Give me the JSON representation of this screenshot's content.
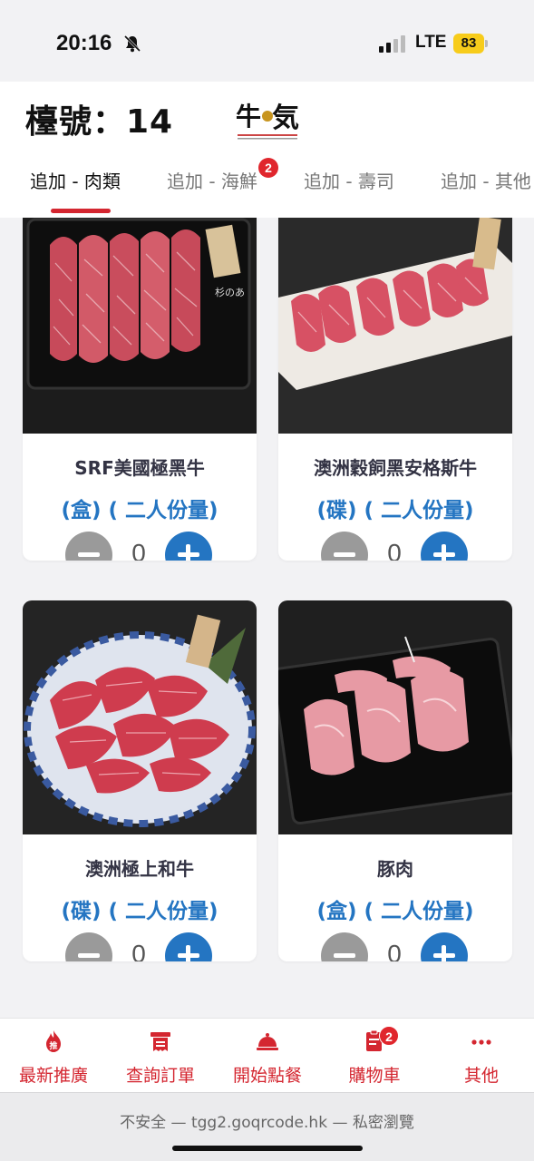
{
  "status": {
    "time": "20:16",
    "network": "LTE",
    "battery": "83"
  },
  "header": {
    "table_label": "檯號：14",
    "tabs": [
      {
        "label": "追加 - 肉類",
        "active": true
      },
      {
        "label": "追加 - 海鮮",
        "badge": "2"
      },
      {
        "label": "追加 - 壽司"
      },
      {
        "label": "追加 - 其他"
      }
    ]
  },
  "products": [
    {
      "name": "SRF美國極黑牛",
      "portion": "(盒) ( 二人份量)",
      "quantity": "0",
      "image": "beef-slices-in-tray"
    },
    {
      "name": "澳洲穀飼黑安格斯牛",
      "portion": "(碟) ( 二人份量)",
      "quantity": "0",
      "image": "angus-beef-on-plate"
    },
    {
      "name": "澳洲極上和牛",
      "portion": "(碟) ( 二人份量)",
      "quantity": "0",
      "image": "wagyu-on-blue-plate"
    },
    {
      "name": "豚肉",
      "portion": "(盒) ( 二人份量)",
      "quantity": "0",
      "image": "pork-slices-in-tray"
    }
  ],
  "bottom_nav": [
    {
      "label": "最新推廣",
      "icon": "fire-icon"
    },
    {
      "label": "查詢訂單",
      "icon": "receipt-icon"
    },
    {
      "label": "開始點餐",
      "icon": "cloche-icon"
    },
    {
      "label": "購物車",
      "icon": "cart-list-icon",
      "badge": "2"
    },
    {
      "label": "其他",
      "icon": "more-icon"
    }
  ],
  "browser": {
    "url_line": "不安全 — tgg2.goqrcode.hk — 私密瀏覽"
  },
  "colors": {
    "accent_red": "#d42630",
    "accent_blue": "#2475c2",
    "minus_gray": "#9a9a9a"
  }
}
